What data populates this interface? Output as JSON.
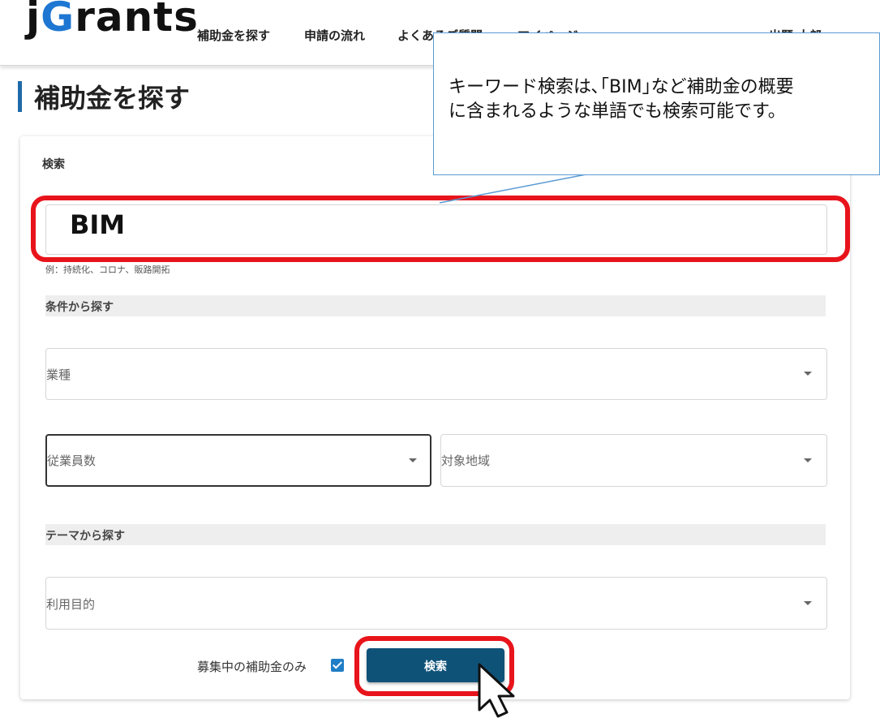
{
  "app": {
    "logo_j": "j",
    "logo_g": "G",
    "logo_rest": "rants"
  },
  "nav": {
    "items": [
      "補助金を探す",
      "申請の流れ",
      "よくあるご質問",
      "マイページ"
    ],
    "user": "出題 太郎"
  },
  "page": {
    "title": "補助金を探す"
  },
  "search": {
    "section_label": "検索",
    "keyword_value": "BIM",
    "hint": "例：持続化、コロナ、販路開拓",
    "conditions_header": "条件から探す",
    "industry_placeholder": "業種",
    "employees_placeholder": "従業員数",
    "region_placeholder": "対象地域",
    "theme_header": "テーマから探す",
    "purpose_placeholder": "利用目的",
    "only_open_label": "募集中の補助金のみ",
    "only_open_checked": true,
    "search_button": "検索"
  },
  "annotation": {
    "callout_line1": "キーワード検索は､｢BIM｣など補助金の概要",
    "callout_line2": "に含まれるような単語でも検索可能です。",
    "highlight_color": "#e8141b",
    "callout_border_color": "#5b9bd5"
  },
  "colors": {
    "brand_blue": "#1d76d2",
    "button": "#0f5278",
    "checkbox": "#1f7ec6",
    "title_bar": "#1f6aa8"
  }
}
